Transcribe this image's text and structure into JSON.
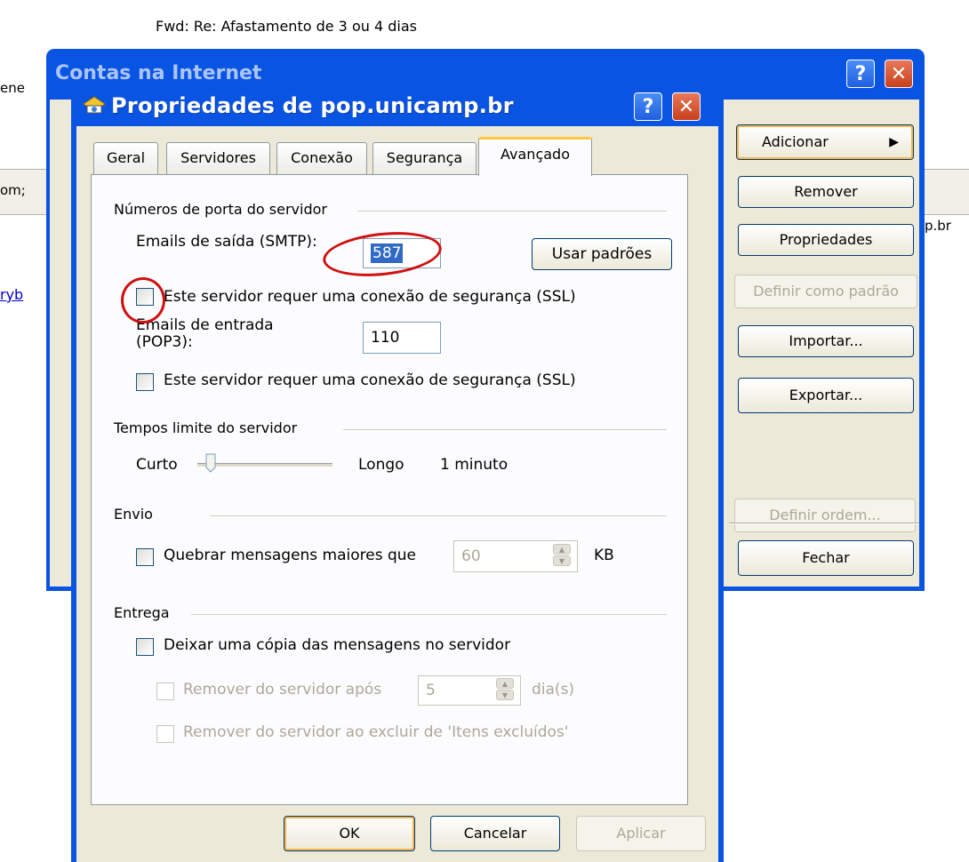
{
  "background": {
    "subject": "Fwd: Re: Afastamento de 3 ou 4 dias",
    "left_text_1": "ene",
    "left_text_2": "om;",
    "right_text_2": "p.br",
    "left_link": "ryb"
  },
  "outer_window": {
    "title": "Contas na Internet",
    "help_label": "?",
    "close_label": "✕",
    "buttons": {
      "adicionar": "Adicionar",
      "adicionar_arrow": "▶",
      "remover": "Remover",
      "propriedades": "Propriedades",
      "definir_padrao": "Definir como padrão",
      "importar": "Importar...",
      "exportar": "Exportar...",
      "definir_ordem": "Definir ordem...",
      "fechar": "Fechar"
    }
  },
  "dialog": {
    "title": "Propriedades de pop.unicamp.br",
    "help_label": "?",
    "close_label": "✕",
    "tabs": [
      "Geral",
      "Servidores",
      "Conexão",
      "Segurança",
      "Avançado"
    ],
    "active_tab": "Avançado",
    "port_group": {
      "label": "Números de porta do servidor",
      "smtp_label": "Emails de saída (SMTP):",
      "smtp_value": "587",
      "usar_padroes": "Usar padrões",
      "smtp_ssl_label": "Este servidor requer uma conexão de segurança (SSL)",
      "smtp_ssl_checked": false,
      "pop3_label_line1": "Emails de entrada",
      "pop3_label_line2": "(POP3):",
      "pop3_value": "110",
      "pop3_ssl_label": "Este servidor requer uma conexão de segurança (SSL)",
      "pop3_ssl_checked": false
    },
    "timeout_group": {
      "label": "Tempos limite do servidor",
      "short": "Curto",
      "long": "Longo",
      "value": "1 minuto",
      "slider_level": 0.1
    },
    "send_group": {
      "label": "Envio",
      "break_label": "Quebrar mensagens maiores que",
      "break_value": "60",
      "unit": "KB",
      "break_checked": false
    },
    "delivery_group": {
      "label": "Entrega",
      "keep_copy": "Deixar uma cópia das mensagens no servidor",
      "remove_after": "Remover do servidor após",
      "remove_after_value": "5",
      "days": "dia(s)",
      "remove_deleted": "Remover do servidor ao excluir de 'Itens excluídos'"
    },
    "buttons": {
      "ok": "OK",
      "cancel": "Cancelar",
      "apply": "Aplicar"
    }
  },
  "colors": {
    "annotation": "#d01010",
    "titlebar": "#0a54e3",
    "dialog_bg": "#ece9d8"
  }
}
